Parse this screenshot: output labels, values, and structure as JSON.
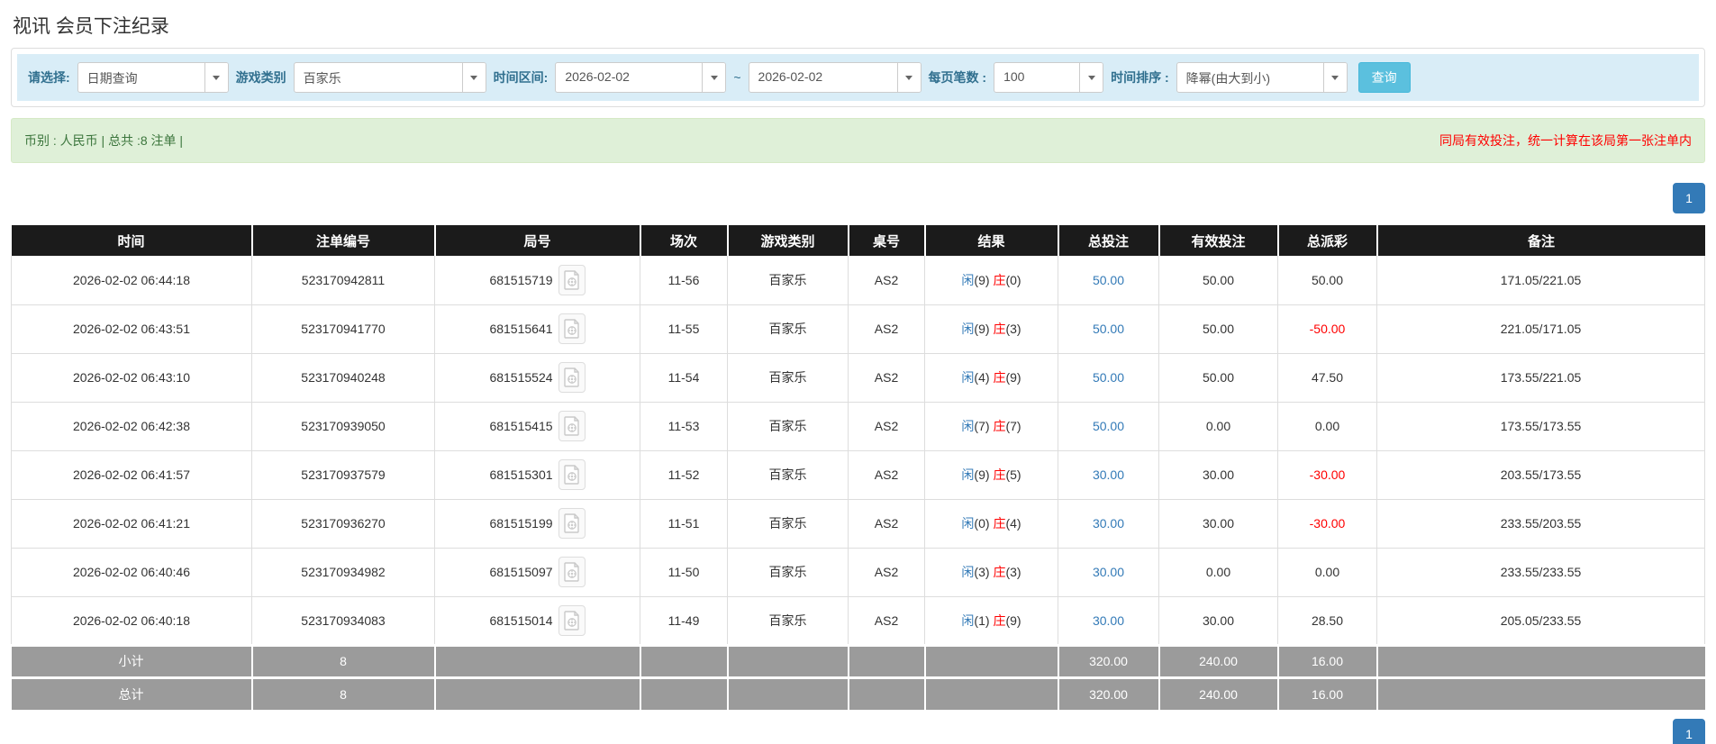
{
  "page_title": "视讯 会员下注纪录",
  "filters": {
    "select_label": "请选择:",
    "select_value": "日期查询",
    "game_type_label": "游戏类别",
    "game_type_value": "百家乐",
    "date_range_label": "时间区间:",
    "date_from": "2026-02-02",
    "tilde": "~",
    "date_to": "2026-02-02",
    "per_page_label": "每页笔数 :",
    "per_page_value": "100",
    "sort_label": "时间排序 :",
    "sort_value": "降幂(由大到小)",
    "search_button": "查询"
  },
  "summary": {
    "left_text": "币别 : 人民币 | 总共 :8 注单 |",
    "right_notice": "同局有效投注，统一计算在该局第一张注单内"
  },
  "pagination": {
    "current_page": "1"
  },
  "icons": {
    "round_video": "video-record-icon",
    "dropdown": "chevron-down-icon"
  },
  "colors": {
    "filter_bg": "#d9edf7",
    "filter_label": "#31708f",
    "summary_bg": "#dff0d8",
    "summary_text": "#3c763d",
    "notice_red": "#ff0000",
    "header_bg": "#1b1b1b",
    "footer_bg": "#9b9b9b",
    "link_blue": "#337ab7",
    "banker_red": "#ff0000",
    "search_btn": "#5bc0de",
    "pager_active": "#337ab7"
  },
  "table": {
    "headers": [
      "时间",
      "注单编号",
      "局号",
      "场次",
      "游戏类别",
      "桌号",
      "结果",
      "总投注",
      "有效投注",
      "总派彩",
      "备注"
    ],
    "rows": [
      {
        "time": "2026-02-02 06:44:18",
        "bet_id": "523170942811",
        "round_id": "681515719",
        "session": "11-56",
        "game": "百家乐",
        "table_no": "AS2",
        "player_label": "闲",
        "player_val": "(9)",
        "banker_label": "庄",
        "banker_val": "(0)",
        "total_bet": "50.00",
        "valid_bet": "50.00",
        "payout": "50.00",
        "remark": "171.05/221.05"
      },
      {
        "time": "2026-02-02 06:43:51",
        "bet_id": "523170941770",
        "round_id": "681515641",
        "session": "11-55",
        "game": "百家乐",
        "table_no": "AS2",
        "player_label": "闲",
        "player_val": "(9)",
        "banker_label": "庄",
        "banker_val": "(3)",
        "total_bet": "50.00",
        "valid_bet": "50.00",
        "payout": "-50.00",
        "remark": "221.05/171.05"
      },
      {
        "time": "2026-02-02 06:43:10",
        "bet_id": "523170940248",
        "round_id": "681515524",
        "session": "11-54",
        "game": "百家乐",
        "table_no": "AS2",
        "player_label": "闲",
        "player_val": "(4)",
        "banker_label": "庄",
        "banker_val": "(9)",
        "total_bet": "50.00",
        "valid_bet": "50.00",
        "payout": "47.50",
        "remark": "173.55/221.05"
      },
      {
        "time": "2026-02-02 06:42:38",
        "bet_id": "523170939050",
        "round_id": "681515415",
        "session": "11-53",
        "game": "百家乐",
        "table_no": "AS2",
        "player_label": "闲",
        "player_val": "(7)",
        "banker_label": "庄",
        "banker_val": "(7)",
        "total_bet": "50.00",
        "valid_bet": "0.00",
        "payout": "0.00",
        "remark": "173.55/173.55"
      },
      {
        "time": "2026-02-02 06:41:57",
        "bet_id": "523170937579",
        "round_id": "681515301",
        "session": "11-52",
        "game": "百家乐",
        "table_no": "AS2",
        "player_label": "闲",
        "player_val": "(9)",
        "banker_label": "庄",
        "banker_val": "(5)",
        "total_bet": "30.00",
        "valid_bet": "30.00",
        "payout": "-30.00",
        "remark": "203.55/173.55"
      },
      {
        "time": "2026-02-02 06:41:21",
        "bet_id": "523170936270",
        "round_id": "681515199",
        "session": "11-51",
        "game": "百家乐",
        "table_no": "AS2",
        "player_label": "闲",
        "player_val": "(0)",
        "banker_label": "庄",
        "banker_val": "(4)",
        "total_bet": "30.00",
        "valid_bet": "30.00",
        "payout": "-30.00",
        "remark": "233.55/203.55"
      },
      {
        "time": "2026-02-02 06:40:46",
        "bet_id": "523170934982",
        "round_id": "681515097",
        "session": "11-50",
        "game": "百家乐",
        "table_no": "AS2",
        "player_label": "闲",
        "player_val": "(3)",
        "banker_label": "庄",
        "banker_val": "(3)",
        "total_bet": "30.00",
        "valid_bet": "0.00",
        "payout": "0.00",
        "remark": "233.55/233.55"
      },
      {
        "time": "2026-02-02 06:40:18",
        "bet_id": "523170934083",
        "round_id": "681515014",
        "session": "11-49",
        "game": "百家乐",
        "table_no": "AS2",
        "player_label": "闲",
        "player_val": "(1)",
        "banker_label": "庄",
        "banker_val": "(9)",
        "total_bet": "30.00",
        "valid_bet": "30.00",
        "payout": "28.50",
        "remark": "205.05/233.55"
      }
    ],
    "subtotal": {
      "label": "小计",
      "count": "8",
      "total_bet": "320.00",
      "valid_bet": "240.00",
      "payout": "16.00"
    },
    "total": {
      "label": "总计",
      "count": "8",
      "total_bet": "320.00",
      "valid_bet": "240.00",
      "payout": "16.00"
    }
  }
}
